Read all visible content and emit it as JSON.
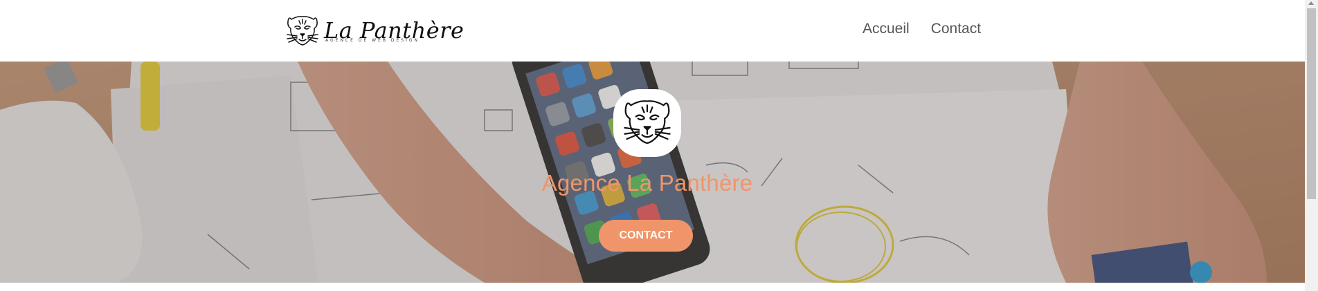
{
  "header": {
    "brand_name": "La Panthère",
    "brand_tagline": "AGENCE DE WEB DESIGN",
    "logo_icon": "panther-head-icon",
    "nav": [
      {
        "label": "Accueil"
      },
      {
        "label": "Contact"
      }
    ]
  },
  "hero": {
    "avatar_icon": "panther-head-icon",
    "title": "Agence La Panthère",
    "button_label": "CONTACT"
  },
  "colors": {
    "accent": "#f0956a",
    "nav_text": "#555555",
    "header_bg": "#ffffff"
  }
}
